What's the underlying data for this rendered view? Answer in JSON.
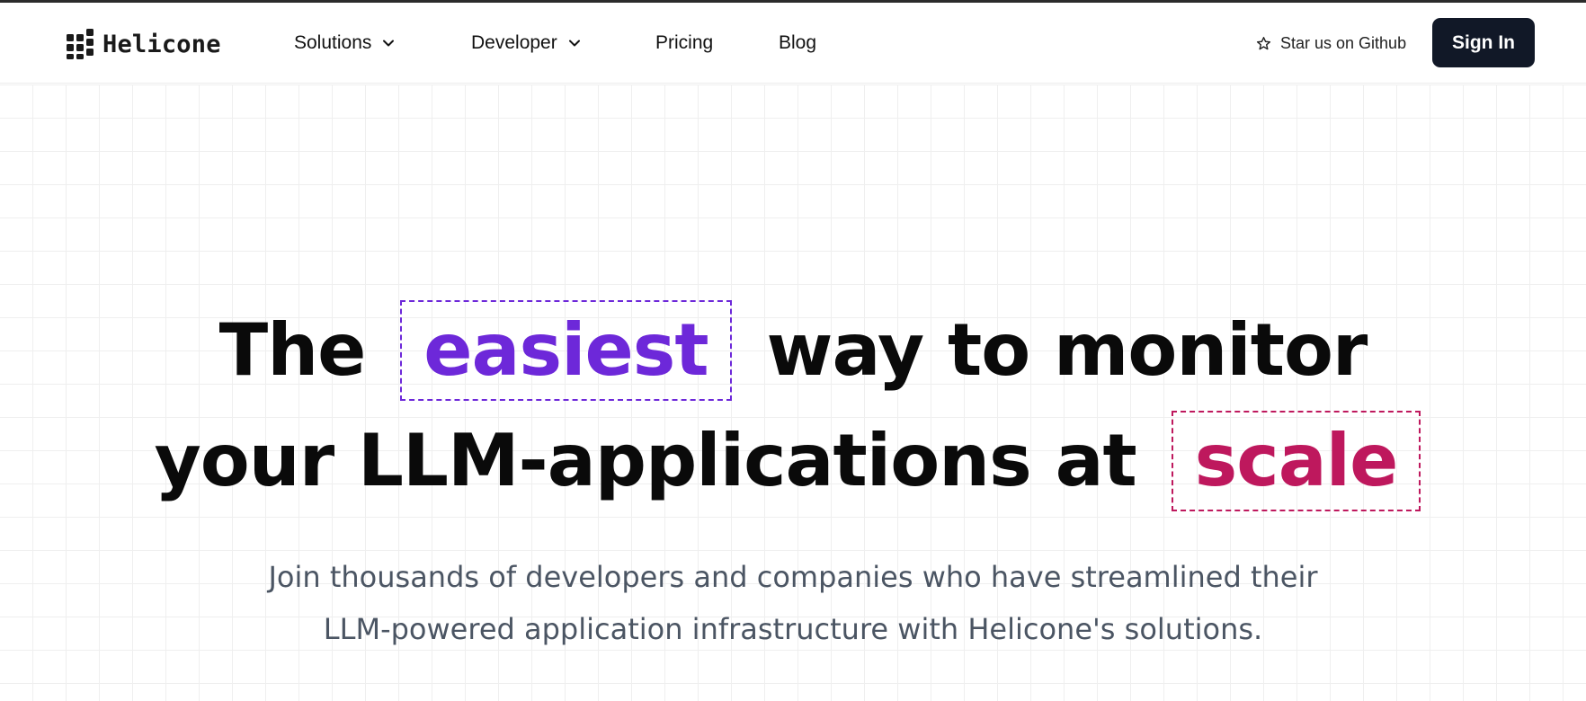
{
  "brand": {
    "name": "Helicone",
    "logo_icon": "grid-dots-logo-icon"
  },
  "nav": {
    "items": [
      {
        "label": "Solutions",
        "has_dropdown": true
      },
      {
        "label": "Developer",
        "has_dropdown": true
      },
      {
        "label": "Pricing",
        "has_dropdown": false
      },
      {
        "label": "Blog",
        "has_dropdown": false
      }
    ]
  },
  "header_actions": {
    "github_label": "Star us on Github",
    "github_icon": "star-icon",
    "signin_label": "Sign In"
  },
  "hero": {
    "line1_pre": "The",
    "line1_highlight": "easiest",
    "line1_post": "way to monitor",
    "line2_pre": "your LLM-applications at",
    "line2_highlight": "scale",
    "subtitle_line1": "Join thousands of developers and companies who have streamlined their",
    "subtitle_line2": "LLM-powered application infrastructure with Helicone's solutions."
  },
  "colors": {
    "highlight_purple": "#6d28d9",
    "highlight_pink": "#be185d",
    "signin_bg": "#111827",
    "subtitle": "#4b5563"
  }
}
